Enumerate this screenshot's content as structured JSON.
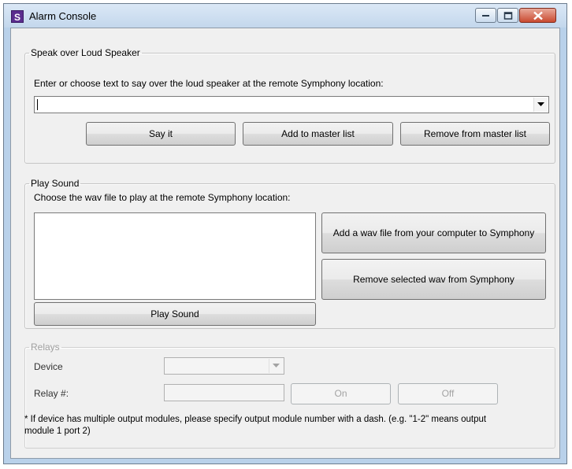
{
  "window": {
    "title": "Alarm Console",
    "app_icon_letter": "S"
  },
  "speak": {
    "legend": "Speak over Loud Speaker",
    "instruction": "Enter or choose text to say over the loud speaker at the remote Symphony location:",
    "text_value": "",
    "say_label": "Say it",
    "add_label": "Add to master list",
    "remove_label": "Remove from master list"
  },
  "play": {
    "legend": "Play Sound",
    "instruction": "Choose the wav file to play at the remote Symphony location:",
    "add_wav_label": "Add a wav file from your computer to Symphony",
    "remove_wav_label": "Remove selected wav from Symphony",
    "play_label": "Play Sound"
  },
  "relays": {
    "legend": "Relays",
    "device_label": "Device",
    "relay_label": "Relay #:",
    "device_value": "",
    "relay_value": "",
    "on_label": "On",
    "off_label": "Off",
    "note": "* If device has multiple output modules, please specify output module number with a dash. (e.g. \"1-2\" means output module 1 port 2)"
  },
  "colors": {
    "titlebar": "#c3d7ec",
    "close_button": "#c94a30",
    "client_bg": "#f0f0f0",
    "disabled_text": "#a3a3a3"
  },
  "icons": {
    "minimize": "minimize-icon",
    "maximize": "maximize-icon",
    "close": "close-icon",
    "dropdown": "chevron-down-icon"
  }
}
